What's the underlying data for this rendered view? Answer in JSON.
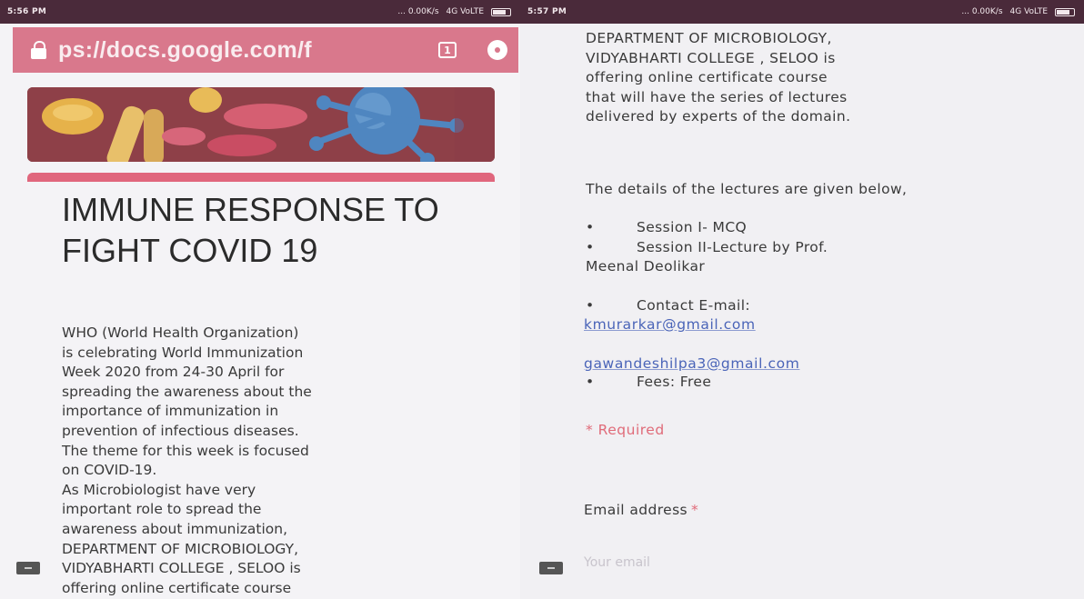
{
  "status_left": {
    "time": "5:56 PM",
    "speed": "... 0.00K/s",
    "network": "4G VoLTE"
  },
  "status_right": {
    "time": "5:57 PM",
    "speed": "... 0.00K/s",
    "network": "4G VoLTE"
  },
  "browser": {
    "url": "ps://docs.google.com/f",
    "tabs_count": "1"
  },
  "form": {
    "title": "IMMUNE RESPONSE TO FIGHT COVID 19",
    "description_left": "WHO (World Health Organization)\nis celebrating World Immunization\nWeek 2020 from 24-30 April for\nspreading the awareness about the\nimportance of immunization in\nprevention of infectious diseases.\nThe theme for this week is focused\non COVID-19.\nAs Microbiologist have very\nimportant role to spread the\nawareness about immunization,\nDEPARTMENT OF MICROBIOLOGY,\nVIDYABHARTI COLLEGE , SELOO is\noffering online certificate course",
    "description_right": "DEPARTMENT OF MICROBIOLOGY,\nVIDYABHARTI COLLEGE , SELOO is\noffering online certificate course\nthat will have the series of lectures\ndelivered by experts of the domain.",
    "details_intro": "The details of the lectures are given below,",
    "bullets": {
      "session1": "Session I- MCQ",
      "session2": "Session II-Lecture by Prof.",
      "session2_cont": "Meenal Deolikar",
      "contact": "Contact E-mail:",
      "fees": "Fees: Free"
    },
    "bullet_symbol": "•",
    "emails": [
      "kmurarkar@gmail.com",
      "gawandeshilpa3@gmail.com"
    ],
    "required_note": "* Required",
    "email_field": {
      "label": "Email address",
      "required_mark": "*",
      "placeholder": "Your email"
    }
  },
  "colors": {
    "accent": "#e0667d",
    "url_bar": "#d9788c",
    "link": "#4a64b8",
    "required": "#e06b79"
  }
}
